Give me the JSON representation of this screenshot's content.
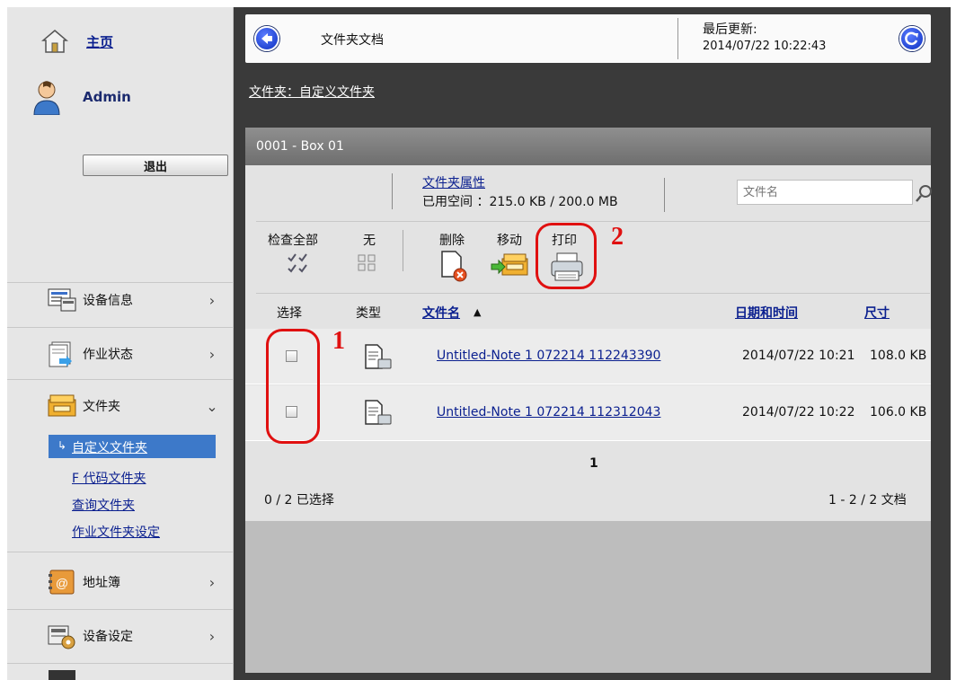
{
  "sidebar": {
    "home_label": "主页",
    "user_label": "Admin",
    "logout_label": "退出",
    "items": [
      {
        "label": "设备信息",
        "icon": "device-info-icon",
        "chevron": "›"
      },
      {
        "label": "作业状态",
        "icon": "job-status-icon",
        "chevron": "›"
      },
      {
        "label": "文件夹",
        "icon": "folder-icon",
        "chevron": "⌄"
      },
      {
        "label": "地址簿",
        "icon": "address-book-icon",
        "chevron": "›"
      },
      {
        "label": "设备设定",
        "icon": "device-settings-icon",
        "chevron": "›"
      }
    ],
    "sub_items": {
      "active": "自定义文件夹",
      "fcode": "F 代码文件夹",
      "polling": "查询文件夹",
      "job_box": "作业文件夹设定"
    }
  },
  "topbar": {
    "title": "文件夹文档",
    "last_update_label": "最后更新:",
    "last_update_value": "2014/07/22 10:22:43"
  },
  "folder_path": "文件夹：自定义文件夹",
  "panel": {
    "header": "0001 - Box 01",
    "properties_link": "文件夹属性",
    "used_space": "已用空间 ：215.0 KB / 200.0 MB",
    "search_placeholder": "文件名",
    "toolbar": {
      "check_all": "检查全部",
      "none": "无",
      "delete": "删除",
      "move": "移动",
      "print": "打印"
    },
    "columns": {
      "select": "选择",
      "type": "类型",
      "filename": "文件名",
      "datetime": "日期和时间",
      "size": "尺寸"
    },
    "rows": [
      {
        "name": "Untitled-Note 1 072214 112243390",
        "date": "2014/07/22 10:21",
        "size": "108.0 KB"
      },
      {
        "name": "Untitled-Note 1 072214 112312043",
        "date": "2014/07/22 10:22",
        "size": "106.0 KB"
      }
    ],
    "page_number": "1",
    "selected_count": "0 / 2 已选择",
    "doc_range": "1 - 2 / 2 文档"
  },
  "annotations": {
    "one": "1",
    "two": "2"
  },
  "colors": {
    "accent": "#0c2fc0",
    "annotation": "#e01010",
    "link": "#0a1f8f"
  }
}
